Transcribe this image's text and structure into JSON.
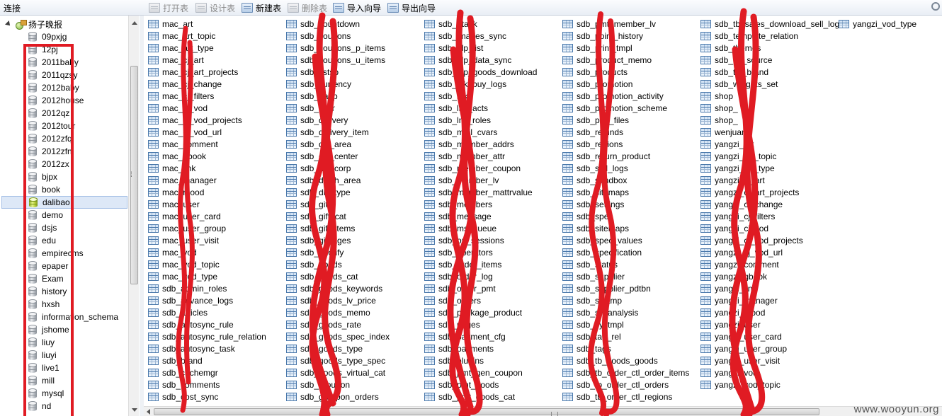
{
  "toolbar": {
    "connection_label": "连接",
    "open_table": "打开表",
    "design_table": "设计表",
    "new_table": "新建表",
    "delete_table": "删除表",
    "import_wizard": "导入向导",
    "export_wizard": "导出向导"
  },
  "tree": {
    "connection_name": "扬子晚报",
    "selected": "dalibao",
    "databases": [
      "09pxjg",
      "12pj",
      "2011baby",
      "2011qzsy",
      "2012baby",
      "2012house",
      "2012qz",
      "2012tour",
      "2012zfq",
      "2012zfn",
      "2012zx",
      "bjpx",
      "book",
      "dalibao",
      "demo",
      "dsjs",
      "edu",
      "empirecms",
      "epaper",
      "Exam",
      "history",
      "hxsh",
      "information_schema",
      "jshome",
      "liuy",
      "liuyi",
      "live1",
      "mill",
      "mysql",
      "nd"
    ]
  },
  "tables": {
    "col1": [
      "mac_art",
      "mac_art_topic",
      "mac_art_type",
      "mac_cj_art",
      "mac_cj_art_projects",
      "mac_cj_change",
      "mac_cj_filters",
      "mac_cj_vod",
      "mac_cj_vod_projects",
      "mac_cj_vod_url",
      "mac_comment",
      "mac_gbook",
      "mac_link",
      "mac_manager",
      "mac_mood",
      "mac_user",
      "mac_user_card",
      "mac_user_group",
      "mac_user_visit",
      "mac_vod",
      "mac_vod_topic",
      "mac_vod_type",
      "sdb_admin_roles",
      "sdb_advance_logs",
      "sdb_articles",
      "sdb_autosync_rule",
      "sdb_autosync_rule_relation",
      "sdb_autosync_task",
      "sdb_brand",
      "sdb_cachemgr",
      "sdb_comments",
      "sdb_cost_sync"
    ],
    "col2": [
      "sdb_countdown",
      "sdb_coupons",
      "sdb_coupons_p_items",
      "sdb_coupons_u_items",
      "sdb_cstsp",
      "sdb_currency",
      "sdb_dapp",
      "sdb_dcvr",
      "sdb_delivery",
      "sdb_delivery_item",
      "sdb_dly_area",
      "sdb_dly_center",
      "sdb_dly_corp",
      "sdb_dly_h_area",
      "sdb_dly_type",
      "sdb_gift",
      "sdb_gift_cat",
      "sdb_gift_items",
      "sdb_gimages",
      "sdb_gnotify",
      "sdb_goods",
      "sdb_goods_cat",
      "sdb_goods_keywords",
      "sdb_goods_lv_price",
      "sdb_goods_memo",
      "sdb_goods_rate",
      "sdb_goods_spec_index",
      "sdb_goods_type",
      "sdb_goods_type_spec",
      "sdb_goods_virtual_cat",
      "sdb_groupon",
      "sdb_groupon_orders"
    ],
    "col3": [
      "sdb_gtask",
      "sdb_images_sync",
      "sdb_jdp_list",
      "sdb_jdp_data_sync",
      "sdb_jdp_goods_download",
      "sdb_lnk_buy_logs",
      "sdb_lnk",
      "sdb_lnk_acts",
      "sdb_lnk_roles",
      "sdb_mail_cvars",
      "sdb_member_addrs",
      "sdb_member_attr",
      "sdb_member_coupon",
      "sdb_member_lv",
      "sdb_member_mattrvalue",
      "sdb_members",
      "sdb_message",
      "sdb_msgqueue",
      "sdb_op_sessions",
      "sdb_operators",
      "sdb_order_items",
      "sdb_order_log",
      "sdb_order_pmt",
      "sdb_orders",
      "sdb_package_product",
      "sdb_pages",
      "sdb_payment_cfg",
      "sdb_payments",
      "sdb_plugins",
      "sdb_pmt_gen_coupon",
      "sdb_pmt_goods",
      "sdb_pmt_goods_cat"
    ],
    "col4": [
      "sdb_pmt_member_lv",
      "sdb_point_history",
      "sdb_print_tmpl",
      "sdb_product_memo",
      "sdb_products",
      "sdb_promotion",
      "sdb_promotion_activity",
      "sdb_promotion_scheme",
      "sdb_pub_files",
      "sdb_refunds",
      "sdb_regions",
      "sdb_return_product",
      "sdb_sell_logs",
      "sdb_sendbox",
      "sdb_sitemaps",
      "sdb_settings",
      "sdb_spec",
      "sdb_sitemaps",
      "sdb_spec_values",
      "sdb_specification",
      "sdb_status",
      "sdb_supplier",
      "sdb_supplier_pdtbn",
      "sdb_systmp",
      "sdb_sysanalysis",
      "sdb_systmpl",
      "sdb_tag_rel",
      "sdb_tags",
      "sdb_tb_goods_goods",
      "sdb_tb_order_ctl_order_items",
      "sdb_tb_order_ctl_orders",
      "sdb_tb_order_ctl_regions"
    ],
    "col5": [
      "sdb_tb_sales_download_sell_log",
      "sdb_template_relation",
      "sdb_themes",
      "sdb_tpl_source",
      "sdb_tpl_brand",
      "sdb_widgets_set",
      "shop",
      "shop_",
      "shop_",
      "wenjuan",
      "yangzi_art",
      "yangzi_art_topic",
      "yangzi_art_type",
      "yangzi_cj_art",
      "yangzi_cj_art_projects",
      "yangzi_cj_change",
      "yangzi_cj_filters",
      "yangzi_cj_vod",
      "yangzi_cj_vod_projects",
      "yangzi_cj_vod_url",
      "yangzi_comment",
      "yangzi_gbook",
      "yangzi_link",
      "yangzi_manager",
      "yangzi_mood",
      "yangzi_user",
      "yangzi_user_card",
      "yangzi_user_group",
      "yangzi_user_visit",
      "yangzi_vod",
      "yangzi_vod_topic"
    ],
    "col6": [
      "yangzi_vod_type"
    ]
  },
  "watermark": "www.wooyun.org",
  "colors": {
    "redaction": "#e01b23",
    "selection": "#dde8f7"
  }
}
